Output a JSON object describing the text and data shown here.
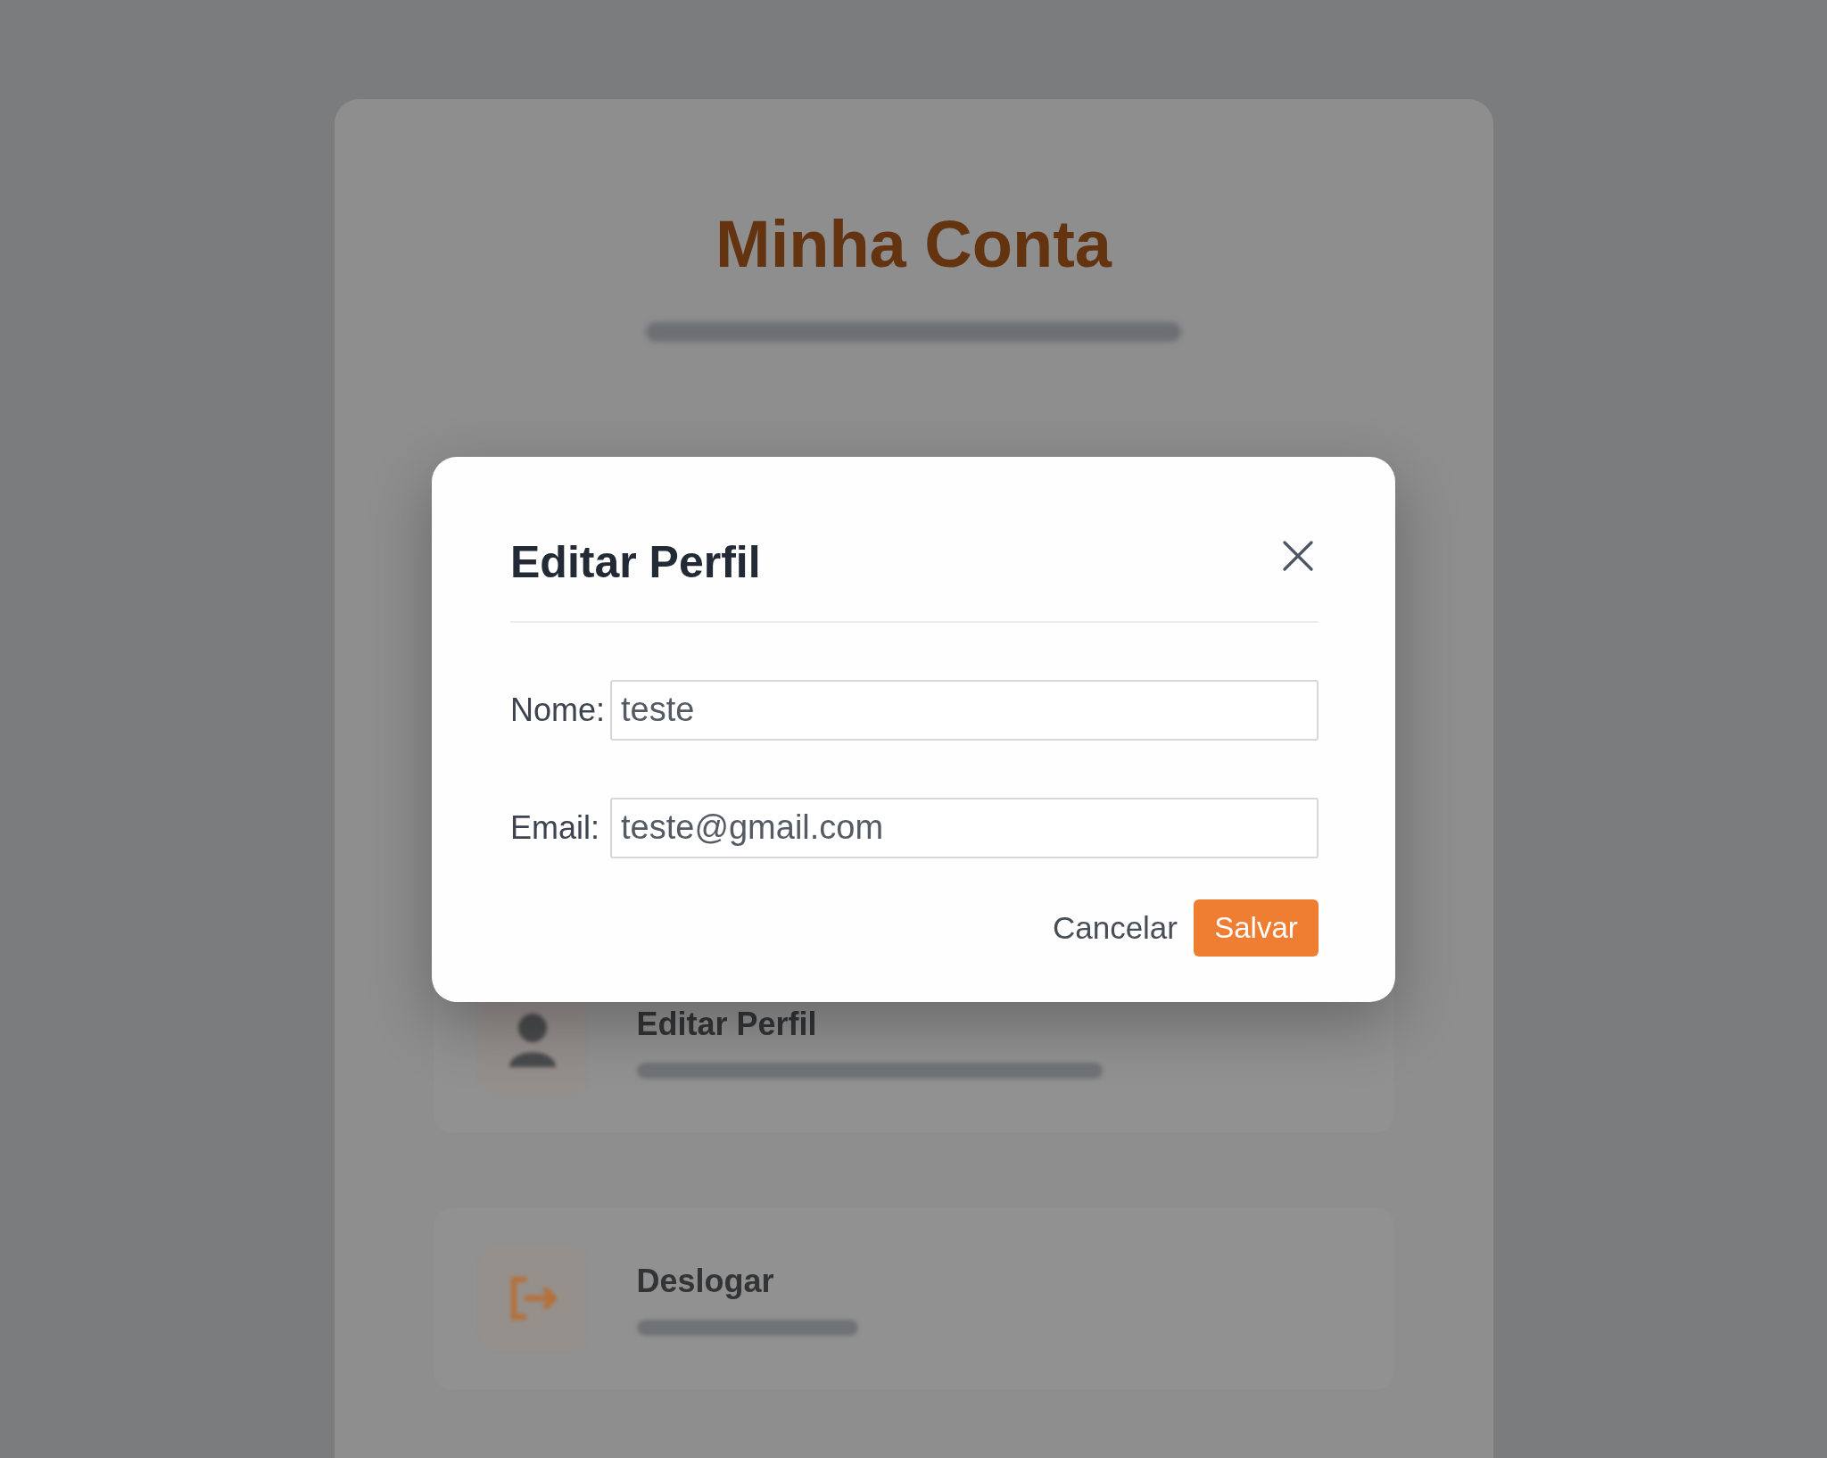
{
  "background_page": {
    "title": "Minha Conta",
    "menu_items": [
      {
        "kind": "profile",
        "title": "Editar Perfil"
      },
      {
        "kind": "logout",
        "title": "Deslogar"
      }
    ]
  },
  "modal": {
    "title": "Editar Perfil",
    "fields": [
      {
        "label": "Nome:",
        "value": "teste"
      },
      {
        "label": "Email:",
        "value": "teste@gmail.com"
      }
    ],
    "buttons": [
      {
        "kind": "secondary",
        "label": "Cancelar"
      },
      {
        "kind": "primary",
        "label": "Salvar"
      }
    ]
  }
}
